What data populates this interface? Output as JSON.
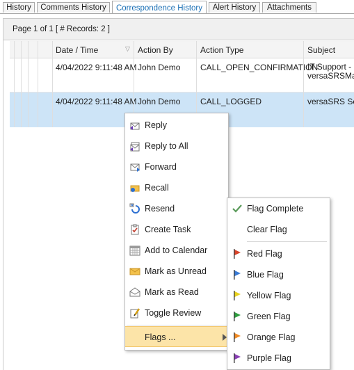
{
  "tabs": [
    "History",
    "Comments History",
    "Correspondence History",
    "Alert History",
    "Attachments"
  ],
  "active_tab": "Correspondence History",
  "pager": {
    "text": "Page 1 of 1 [ # Records: 2 ]"
  },
  "grid": {
    "columns": [
      "Date / Time",
      "Action By",
      "Action Type",
      "Subject"
    ],
    "rows": [
      {
        "datetime": "4/04/2022 9:11:48 AM",
        "action_by": "John Demo",
        "action_type": "CALL_OPEN_CONFIRMATION",
        "subject_line1": "IT Support - F",
        "subject_line2": "versaSRSMail"
      },
      {
        "datetime": "4/04/2022 9:11:48 AM",
        "action_by": "John Demo",
        "action_type": "CALL_LOGGED",
        "subject_line1": "versaSRS Serv",
        "subject_line2": ""
      }
    ]
  },
  "context_menu": {
    "items": [
      {
        "label": "Reply",
        "icon": "reply-icon"
      },
      {
        "label": "Reply to All",
        "icon": "reply-all-icon"
      },
      {
        "label": "Forward",
        "icon": "forward-icon"
      },
      {
        "label": "Recall",
        "icon": "recall-icon"
      },
      {
        "label": "Resend",
        "icon": "resend-icon"
      },
      {
        "label": "Create Task",
        "icon": "task-icon"
      },
      {
        "label": "Add to Calendar",
        "icon": "calendar-icon"
      },
      {
        "label": "Mark as Unread",
        "icon": "unread-icon"
      },
      {
        "label": "Mark as Read",
        "icon": "read-icon"
      },
      {
        "label": "Toggle Review",
        "icon": "review-icon"
      }
    ],
    "flags_label": "Flags ..."
  },
  "flags_menu": {
    "flag_complete": "Flag Complete",
    "clear_flag": "Clear Flag",
    "flags": [
      {
        "label": "Red Flag",
        "color": "#d9452b"
      },
      {
        "label": "Blue Flag",
        "color": "#3a7bd5"
      },
      {
        "label": "Yellow Flag",
        "color": "#e8d21d"
      },
      {
        "label": "Green Flag",
        "color": "#2e9e3e"
      },
      {
        "label": "Orange Flag",
        "color": "#f08a24"
      },
      {
        "label": "Purple Flag",
        "color": "#8a3fb5"
      }
    ]
  }
}
